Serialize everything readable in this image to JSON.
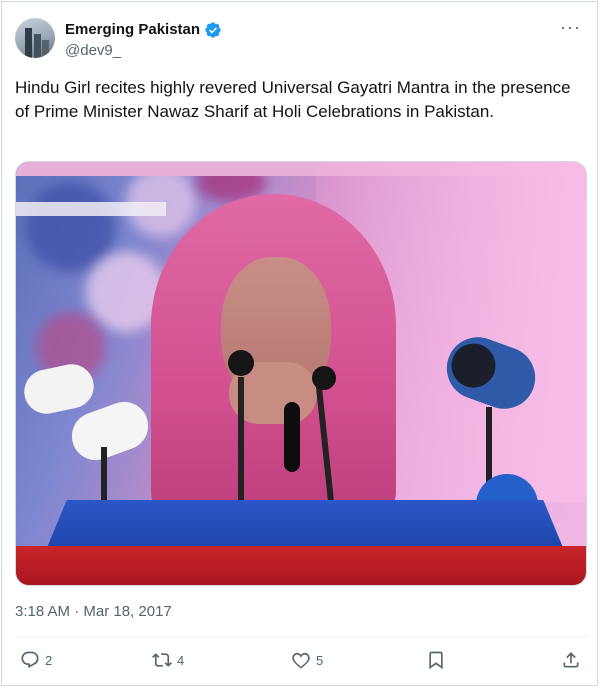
{
  "author": {
    "display_name": "Emerging Pakistan",
    "handle": "@dev9_",
    "verified": true,
    "avatar": "city-skyline-avatar"
  },
  "tweet": {
    "text": "Hindu Girl recites highly revered Universal Gayatri Mantra in the presence of Prime Minister Nawaz Sharif at Holi Celebrations in Pakistan.",
    "timestamp": "3:18 AM · Mar 18, 2017"
  },
  "header": {
    "more_icon": "more-icon",
    "more_label": "···"
  },
  "media": {
    "icon": "video-thumbnail"
  },
  "actions": {
    "reply_count": "2",
    "retweet_count": "4",
    "like_count": "5"
  },
  "colors": {
    "verified_blue": "#1d9bf0",
    "secondary_text": "#536471",
    "border": "#cfd9de"
  }
}
